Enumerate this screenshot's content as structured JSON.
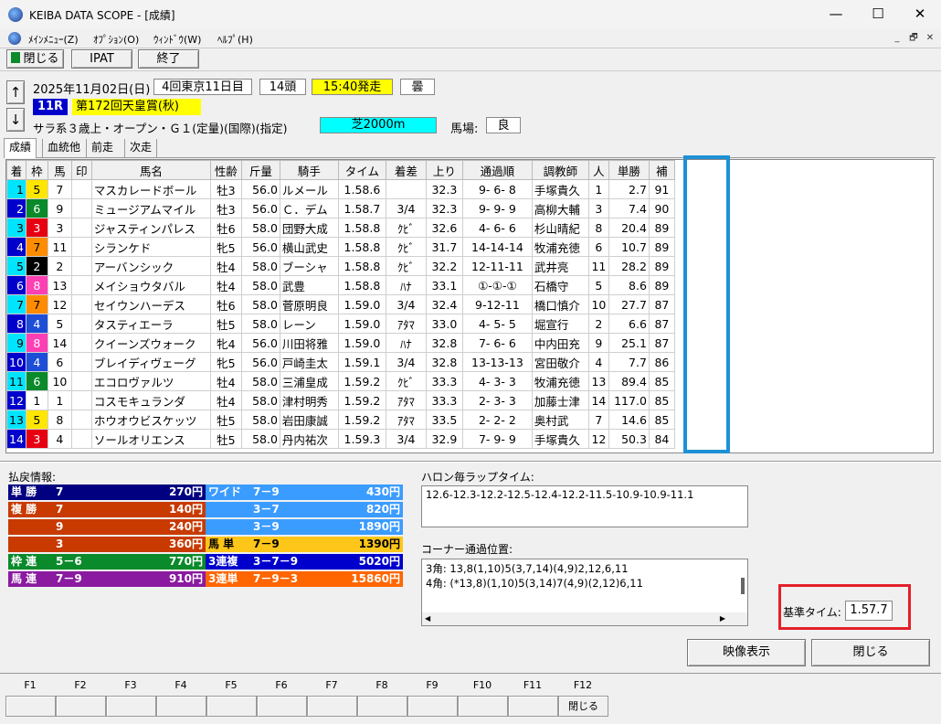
{
  "window": {
    "title": "KEIBA DATA SCOPE - [成績]",
    "minimize": "—",
    "maximize": "☐",
    "close": "✕"
  },
  "menu": {
    "items": [
      "ﾒｲﾝﾒﾆｭｰ(Z)",
      "ｵﾌﾟｼｮﾝ(O)",
      "ｳｨﾝﾄﾞｳ(W)",
      "ﾍﾙﾌﾟ(H)"
    ],
    "mdi_min": "_",
    "mdi_restore": "🗗",
    "mdi_close": "✕"
  },
  "toolbar": {
    "close": "閉じる",
    "ipat": "IPAT",
    "exit": "終了"
  },
  "nav": {
    "up": "↑",
    "down": "↓"
  },
  "race": {
    "date": "2025年11月02日(日)",
    "meeting": "4回東京11日目",
    "heads": "14頭",
    "start": "15:40発走",
    "weather": "曇",
    "rnum": "11R",
    "name": "第172回天皇賞(秋)",
    "cond": "サラ系３歳上・オープン・Ｇ１(定量)(国際)(指定)",
    "course": "芝2000m",
    "baba_label": "馬場:",
    "baba": "良"
  },
  "tabs": [
    "成績",
    "血統他",
    "前走",
    "次走"
  ],
  "table": {
    "headers": [
      "着",
      "枠",
      "馬",
      "印",
      "馬名",
      "性齢",
      "斤量",
      "騎手",
      "タイム",
      "着差",
      "上り",
      "通過順",
      "調教師",
      "人",
      "単勝",
      "補"
    ],
    "rows": [
      [
        "1",
        "5",
        "7",
        "",
        "マスカレードボール",
        "牡3",
        "56.0",
        "ルメール",
        "1.58.6",
        "",
        "32.3",
        "9- 6- 8",
        "手塚貴久",
        "1",
        "2.7",
        "91"
      ],
      [
        "2",
        "6",
        "9",
        "",
        "ミュージアムマイル",
        "牡3",
        "56.0",
        "Ｃ．デム",
        "1.58.7",
        "3/4",
        "32.3",
        "9- 9- 9",
        "高柳大輔",
        "3",
        "7.4",
        "90"
      ],
      [
        "3",
        "3",
        "3",
        "",
        "ジャスティンパレス",
        "牡6",
        "58.0",
        "団野大成",
        "1.58.8",
        "ｸﾋﾞ",
        "32.6",
        "4- 6- 6",
        "杉山晴紀",
        "8",
        "20.4",
        "89"
      ],
      [
        "4",
        "7",
        "11",
        "",
        "シランケド",
        "牝5",
        "56.0",
        "横山武史",
        "1.58.8",
        "ｸﾋﾞ",
        "31.7",
        "14-14-14",
        "牧浦充徳",
        "6",
        "10.7",
        "89"
      ],
      [
        "5",
        "2",
        "2",
        "",
        "アーバンシック",
        "牡4",
        "58.0",
        "ブーシャ",
        "1.58.8",
        "ｸﾋﾞ",
        "32.2",
        "12-11-11",
        "武井亮",
        "11",
        "28.2",
        "89"
      ],
      [
        "6",
        "8",
        "13",
        "",
        "メイショウタバル",
        "牡4",
        "58.0",
        "武豊",
        "1.58.8",
        "ﾊﾅ",
        "33.1",
        "①-①-①",
        "石橋守",
        "5",
        "8.6",
        "89"
      ],
      [
        "7",
        "7",
        "12",
        "",
        "セイウンハーデス",
        "牡6",
        "58.0",
        "菅原明良",
        "1.59.0",
        "3/4",
        "32.4",
        "9-12-11",
        "橋口慎介",
        "10",
        "27.7",
        "87"
      ],
      [
        "8",
        "4",
        "5",
        "",
        "タスティエーラ",
        "牡5",
        "58.0",
        "レーン",
        "1.59.0",
        "ｱﾀﾏ",
        "33.0",
        "4- 5- 5",
        "堀宣行",
        "2",
        "6.6",
        "87"
      ],
      [
        "9",
        "8",
        "14",
        "",
        "クイーンズウォーク",
        "牝4",
        "56.0",
        "川田将雅",
        "1.59.0",
        "ﾊﾅ",
        "32.8",
        "7- 6- 6",
        "中内田充",
        "9",
        "25.1",
        "87"
      ],
      [
        "10",
        "4",
        "6",
        "",
        "ブレイディヴェーグ",
        "牝5",
        "56.0",
        "戸崎圭太",
        "1.59.1",
        "3/4",
        "32.8",
        "13-13-13",
        "宮田敬介",
        "4",
        "7.7",
        "86"
      ],
      [
        "11",
        "6",
        "10",
        "",
        "エコロヴァルツ",
        "牡4",
        "58.0",
        "三浦皇成",
        "1.59.2",
        "ｸﾋﾞ",
        "33.3",
        "4- 3- 3",
        "牧浦充徳",
        "13",
        "89.4",
        "85"
      ],
      [
        "12",
        "1",
        "1",
        "",
        "コスモキュランダ",
        "牡4",
        "58.0",
        "津村明秀",
        "1.59.2",
        "ｱﾀﾏ",
        "33.3",
        "2- 3- 3",
        "加藤士津",
        "14",
        "117.0",
        "85"
      ],
      [
        "13",
        "5",
        "8",
        "",
        "ホウオウビスケッツ",
        "牡5",
        "58.0",
        "岩田康誠",
        "1.59.2",
        "ｱﾀﾏ",
        "33.5",
        "2- 2- 2",
        "奥村武",
        "7",
        "14.6",
        "85"
      ],
      [
        "14",
        "3",
        "4",
        "",
        "ソールオリエンス",
        "牡5",
        "58.0",
        "丹内祐次",
        "1.59.3",
        "3/4",
        "32.9",
        "7- 9- 9",
        "手塚貴久",
        "12",
        "50.3",
        "84"
      ]
    ]
  },
  "payout": {
    "label": "払戻情報:",
    "left": [
      {
        "type": "単 勝",
        "comb": "7",
        "amt": "270円"
      },
      {
        "type": "複 勝",
        "comb": "7",
        "amt": "140円"
      },
      {
        "type": "",
        "comb": "9",
        "amt": "240円"
      },
      {
        "type": "",
        "comb": "3",
        "amt": "360円"
      },
      {
        "type": "枠 連",
        "comb": "5－6",
        "amt": "770円"
      },
      {
        "type": "馬 連",
        "comb": "7－9",
        "amt": "910円"
      }
    ],
    "right": [
      {
        "type": "ワイド",
        "comb": "7－9",
        "amt": "430円"
      },
      {
        "type": "",
        "comb": "3－7",
        "amt": "820円"
      },
      {
        "type": "",
        "comb": "3－9",
        "amt": "1890円"
      },
      {
        "type": "馬 単",
        "comb": "7－9",
        "amt": "1390円"
      },
      {
        "type": "3連複",
        "comb": "3－7－9",
        "amt": "5020円"
      },
      {
        "type": "3連単",
        "comb": "7－9－3",
        "amt": "15860円"
      }
    ]
  },
  "lap": {
    "label": "ハロン毎ラップタイム:",
    "value": "12.6-12.3-12.2-12.5-12.4-12.2-11.5-10.9-10.9-11.1"
  },
  "corner": {
    "label": "コーナー通過位置:",
    "line1": "3角: 13,8(1,10)5(3,7,14)(4,9)2,12,6,11",
    "line2": "4角: (*13,8)(1,10)5(3,14)7(4,9)(2,12)6,11"
  },
  "base_time": {
    "label": "基準タイム:",
    "value": "1.57.7"
  },
  "buttons": {
    "video": "映像表示",
    "close": "閉じる"
  },
  "fkeys": [
    "F1",
    "F2",
    "F3",
    "F4",
    "F5",
    "F6",
    "F7",
    "F8",
    "F9",
    "F10",
    "F11",
    "F12"
  ],
  "f12_label": "閉じる",
  "colors": {
    "waku": [
      "#ffffff",
      "#000000",
      "#e60012",
      "#1d4ed8",
      "#ffe600",
      "#0a8a2a",
      "#ff8c00",
      "#ff3fb4"
    ],
    "start_bg": "#ffff00",
    "course_bg": "#00ffff",
    "rnum_bg": "#0000cc",
    "highlight_blue": "#1e90d6",
    "highlight_red": "#e3202a"
  }
}
